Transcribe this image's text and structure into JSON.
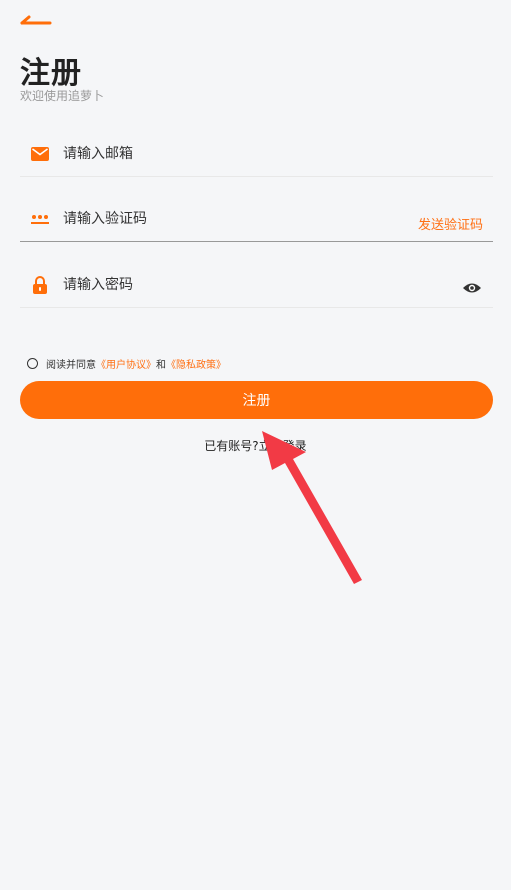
{
  "header": {
    "title": "注册",
    "subtitle": "欢迎使用追萝卜"
  },
  "form": {
    "email": {
      "placeholder": "请输入邮箱",
      "icon": "mail-icon"
    },
    "code": {
      "placeholder": "请输入验证码",
      "icon": "dots-icon",
      "send_label": "发送验证码"
    },
    "password": {
      "placeholder": "请输入密码",
      "icon": "lock-icon",
      "toggle_icon": "eye-icon"
    }
  },
  "agreement": {
    "prefix": "阅读并同意",
    "user_agreement": "《用户协议》",
    "and": "和",
    "privacy_policy": "《隐私政策》"
  },
  "actions": {
    "register_label": "注册",
    "have_account": "已有账号?",
    "login_label": "立即登录"
  },
  "colors": {
    "accent": "#ff6e0a",
    "annotation_arrow": "#f23a45"
  }
}
